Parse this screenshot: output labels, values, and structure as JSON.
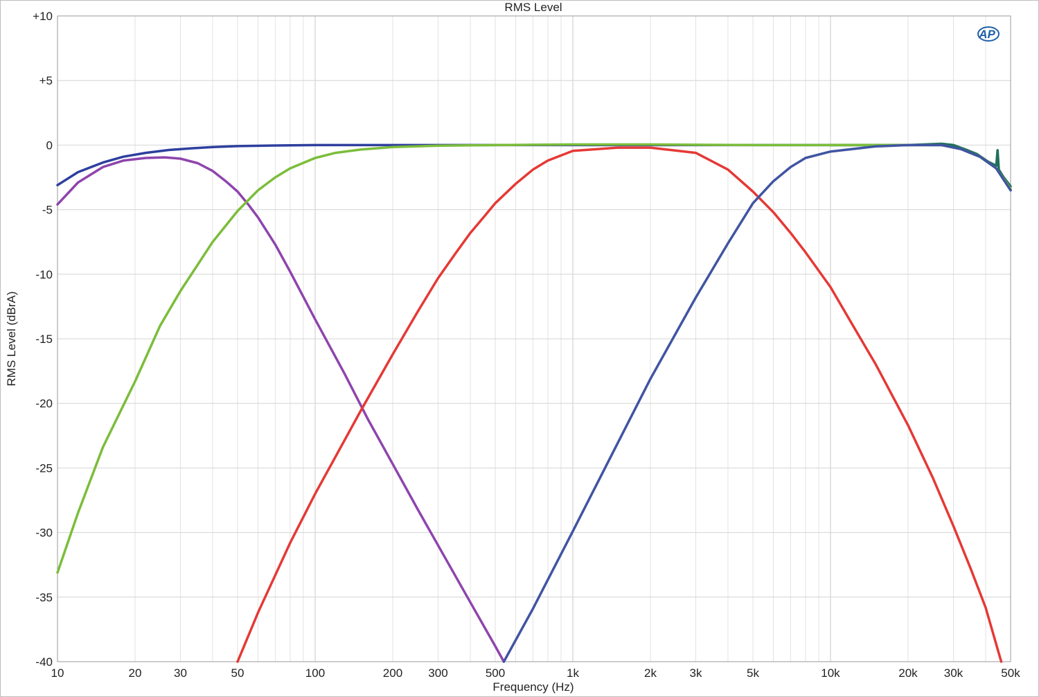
{
  "chart_data": {
    "type": "line",
    "title": "RMS Level",
    "xlabel": "Frequency (Hz)",
    "ylabel": "RMS Level (dBrA)",
    "xscale": "log",
    "xlim": [
      10,
      50000
    ],
    "ylim": [
      -40,
      10
    ],
    "grid": true,
    "x_ticks": [
      10,
      20,
      30,
      50,
      100,
      200,
      300,
      500,
      1000,
      2000,
      3000,
      5000,
      10000,
      20000,
      30000,
      50000
    ],
    "x_tick_labels": [
      "10",
      "20",
      "30",
      "50",
      "100",
      "200",
      "300",
      "500",
      "1k",
      "2k",
      "3k",
      "5k",
      "10k",
      "20k",
      "30k",
      "50k"
    ],
    "y_ticks": [
      10,
      5,
      0,
      -5,
      -10,
      -15,
      -20,
      -25,
      -30,
      -35,
      -40
    ],
    "y_tick_labels": [
      "+10",
      "+5",
      "0",
      "-5",
      "-10",
      "-15",
      "-20",
      "-25",
      "-30",
      "-35",
      "-40"
    ],
    "logo_text": "AP",
    "series": [
      {
        "color": "#2e3f9e",
        "x": [
          10,
          12,
          15,
          18,
          22,
          27,
          33,
          40,
          50,
          70,
          100,
          200,
          500,
          1000,
          2000,
          5000,
          10000,
          20000,
          27000,
          32000,
          38000,
          44000,
          50000
        ],
        "y": [
          -3.1,
          -2.1,
          -1.35,
          -0.9,
          -0.6,
          -0.38,
          -0.25,
          -0.15,
          -0.08,
          -0.03,
          0,
          0,
          0,
          0,
          0,
          0,
          0,
          0,
          0,
          -0.3,
          -0.9,
          -1.8,
          -3.5
        ]
      },
      {
        "color": "#1f6f5a",
        "x": [
          10000,
          20000,
          27000,
          30000,
          33000,
          37000,
          41000,
          44000,
          44500,
          45000,
          47000,
          50000
        ],
        "y": [
          0,
          0,
          0.1,
          0,
          -0.3,
          -0.7,
          -1.3,
          -1.6,
          -0.4,
          -1.9,
          -2.5,
          -3.2
        ]
      },
      {
        "color": "#8e44ad",
        "x": [
          10,
          12,
          15,
          18,
          22,
          26,
          30,
          35,
          40,
          45,
          50,
          55,
          60,
          70,
          80,
          100,
          130,
          160,
          200,
          250,
          300,
          400,
          500,
          540
        ],
        "y": [
          -4.6,
          -2.9,
          -1.7,
          -1.2,
          -1.0,
          -0.95,
          -1.05,
          -1.4,
          -2.0,
          -2.8,
          -3.6,
          -4.6,
          -5.6,
          -7.7,
          -9.8,
          -13.5,
          -17.7,
          -21.2,
          -24.7,
          -28.2,
          -31.0,
          -35.4,
          -38.8,
          -40
        ]
      },
      {
        "color": "#e53935",
        "x": [
          50,
          60,
          80,
          100,
          150,
          200,
          250,
          300,
          350,
          400,
          450,
          500,
          600,
          700,
          800,
          1000,
          1500,
          2000,
          3000,
          4000,
          5000,
          6000,
          7000,
          8000,
          10000,
          12000,
          15000,
          20000,
          25000,
          30000,
          35000,
          40000,
          46000
        ],
        "y": [
          -40,
          -36.2,
          -30.8,
          -27.0,
          -20.6,
          -16.2,
          -12.9,
          -10.3,
          -8.4,
          -6.8,
          -5.6,
          -4.5,
          -3.0,
          -1.9,
          -1.2,
          -0.45,
          -0.2,
          -0.2,
          -0.6,
          -1.9,
          -3.6,
          -5.2,
          -6.8,
          -8.3,
          -11.0,
          -13.7,
          -17.0,
          -21.7,
          -25.8,
          -29.5,
          -32.8,
          -35.8,
          -40
        ]
      },
      {
        "color": "#7bbd3a",
        "x": [
          10,
          12,
          15,
          20,
          25,
          30,
          40,
          50,
          60,
          70,
          80,
          100,
          120,
          150,
          200,
          300,
          500,
          1000,
          2000,
          5000,
          10000,
          20000,
          27000,
          32000,
          38000,
          44000,
          50000
        ],
        "y": [
          -33.1,
          -28.5,
          -23.4,
          -18.3,
          -14.0,
          -11.3,
          -7.5,
          -5.1,
          -3.5,
          -2.5,
          -1.8,
          -1.0,
          -0.6,
          -0.35,
          -0.15,
          -0.05,
          0,
          0.05,
          0.05,
          0,
          0,
          0,
          0,
          -0.3,
          -0.9,
          -1.8,
          -3.4
        ]
      },
      {
        "color": "#4054a2",
        "x": [
          540,
          700,
          1000,
          1500,
          2000,
          3000,
          4000,
          5000,
          6000,
          7000,
          8000,
          10000,
          15000,
          20000,
          27000,
          32000,
          38000,
          44000,
          50000
        ],
        "y": [
          -40,
          -35.9,
          -29.9,
          -23.0,
          -18.1,
          -11.8,
          -7.6,
          -4.5,
          -2.8,
          -1.7,
          -1.0,
          -0.5,
          -0.1,
          0,
          0,
          -0.3,
          -0.9,
          -1.8,
          -3.5
        ]
      }
    ]
  }
}
